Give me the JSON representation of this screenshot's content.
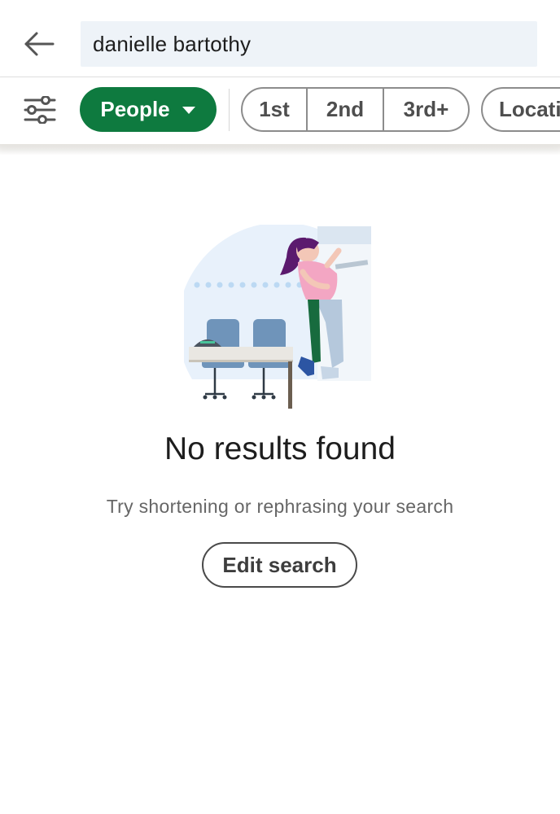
{
  "search": {
    "query": "danielle bartothy"
  },
  "filters": {
    "primary": {
      "label": "People",
      "active": true,
      "color": "#0e7a3f"
    },
    "connection_degrees": [
      "1st",
      "2nd",
      "3rd+"
    ],
    "location_label": "Locati"
  },
  "icons": {
    "back": "arrow-left-icon",
    "filters": "sliders-icon",
    "dropdown": "caret-down-icon"
  },
  "empty_state": {
    "title": "No results found",
    "subtitle": "Try shortening or rephrasing your search",
    "button_label": "Edit search",
    "illustration": "person-at-empty-desk-illustration"
  }
}
